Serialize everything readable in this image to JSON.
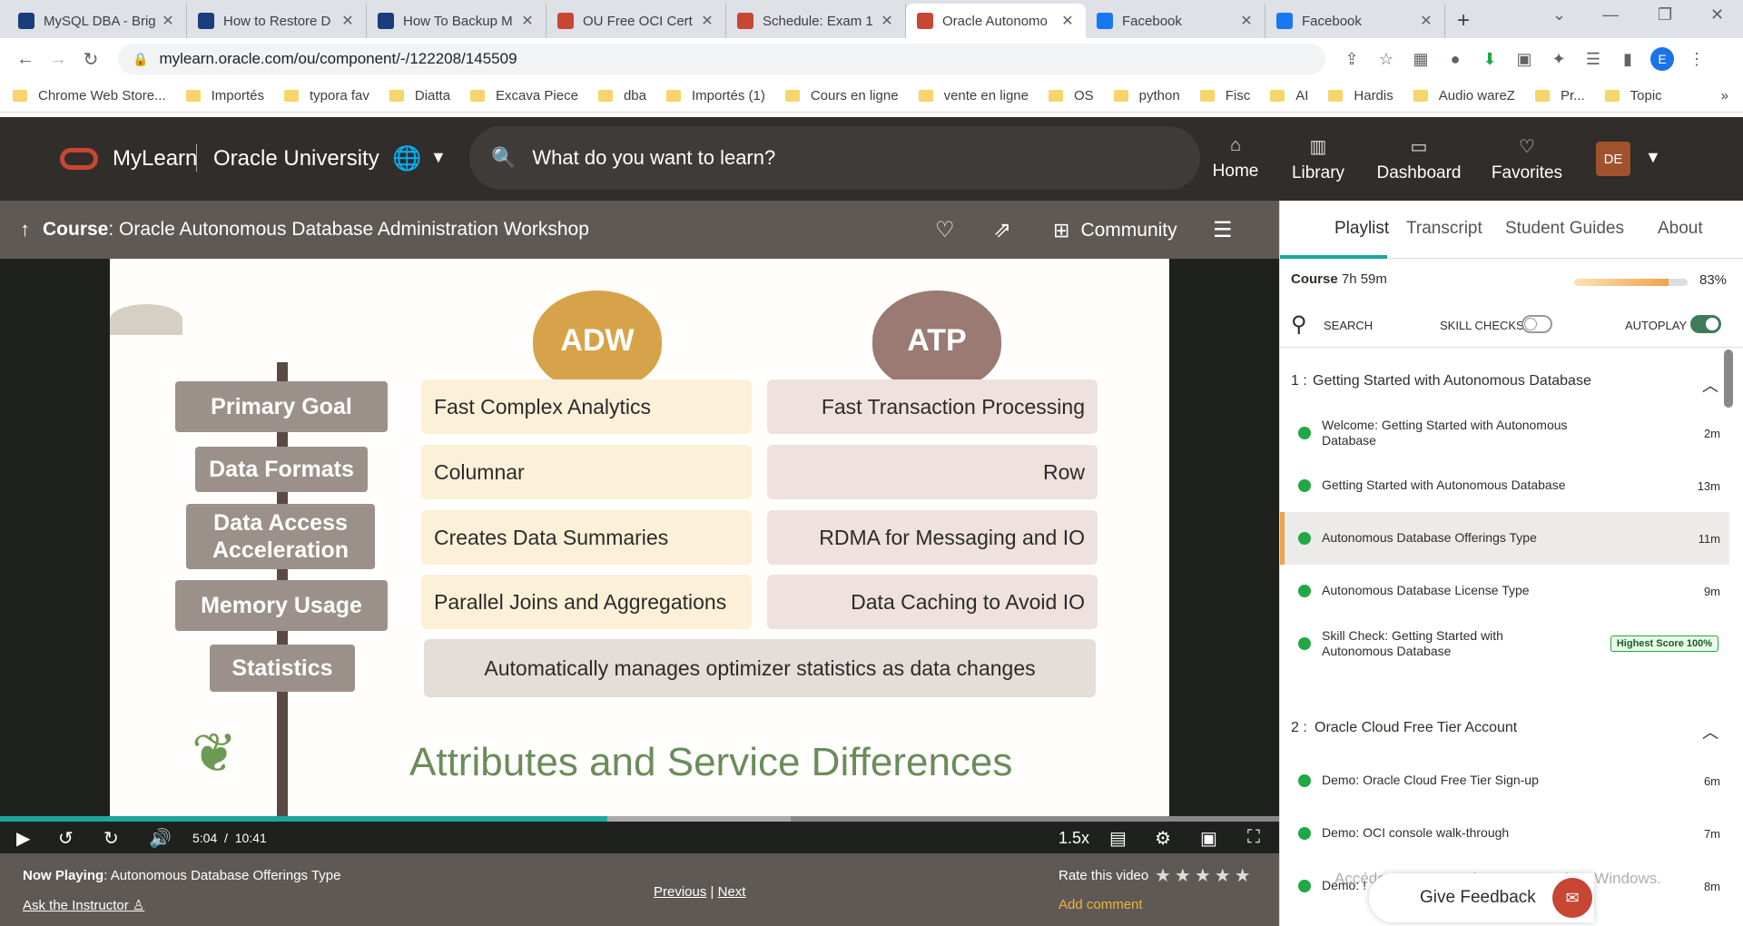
{
  "browser": {
    "tabs": [
      {
        "title": "MySQL DBA - Brig",
        "icon": "web-icon",
        "color": "#1a3e7a"
      },
      {
        "title": "How to Restore D",
        "icon": "web-icon",
        "color": "#1a3e7a"
      },
      {
        "title": "How To Backup M",
        "icon": "web-icon",
        "color": "#1a3e7a"
      },
      {
        "title": "OU Free OCI Cert",
        "icon": "oracle-icon",
        "color": "#c74634"
      },
      {
        "title": "Schedule: Exam 1",
        "icon": "oracle-icon",
        "color": "#c74634"
      },
      {
        "title": "Oracle Autonomo",
        "icon": "oracle-icon",
        "color": "#c74634"
      },
      {
        "title": "Facebook",
        "icon": "facebook-icon",
        "color": "#1877f2"
      },
      {
        "title": "Facebook",
        "icon": "facebook-icon",
        "color": "#1877f2"
      }
    ],
    "active_tab": 5,
    "url": "mylearn.oracle.com/ou/component/-/122208/145509",
    "profile_initial": "E",
    "bookmarks": [
      "Chrome Web Store...",
      "Importés",
      "typora fav",
      "Diatta",
      "Excava Piece",
      "dba",
      "Importés (1)",
      "Cours en ligne",
      "vente en ligne",
      "OS",
      "python",
      "Fisc",
      "AI",
      "Hardis",
      "Audio wareZ",
      "Pr...",
      "Topic"
    ]
  },
  "header": {
    "brand": "MyLearn",
    "org": "Oracle University",
    "search_placeholder": "What do you want to learn?",
    "nav": [
      "Home",
      "Library",
      "Dashboard",
      "Favorites"
    ],
    "user_initials": "DE"
  },
  "course": {
    "prefix": "Course",
    "title": ": Oracle Autonomous Database Administration Workshop",
    "community": "Community"
  },
  "slide": {
    "adw": "ADW",
    "atp": "ATP",
    "signs": [
      "Primary Goal",
      "Data Formats",
      "Data Access Acceleration",
      "Memory Usage",
      "Statistics"
    ],
    "adw_cells": [
      "Fast Complex Analytics",
      "Columnar",
      "Creates Data Summaries",
      "Parallel Joins and Aggregations"
    ],
    "atp_cells": [
      "Fast Transaction Processing",
      "Row",
      "RDMA for Messaging and IO",
      "Data Caching to Avoid IO"
    ],
    "full_cell": "Automatically manages optimizer statistics as data changes",
    "title": "Attributes and Service Differences"
  },
  "player": {
    "current": "5:04",
    "duration": "10:41",
    "played_fraction": 0.475,
    "buffered_fraction": 0.618,
    "speed": "1.5x"
  },
  "now_playing": {
    "label": "Now Playing",
    "title": ": Autonomous Database Offerings Type",
    "ask": "Ask the Instructor",
    "previous": "Previous",
    "divider": "|",
    "next": "Next",
    "rate": "Rate this video",
    "add_comment": "Add comment"
  },
  "panel": {
    "tabs": [
      "Playlist",
      "Transcript",
      "Student Guides",
      "About"
    ],
    "course_label": "Course",
    "course_time": "7h 59m",
    "percent": "83%",
    "percent_value": 0.83,
    "search": "SEARCH",
    "skill_checks": "SKILL CHECKS",
    "autoplay": "AUTOPLAY",
    "sections": [
      {
        "num": "1 :",
        "title": "Getting Started with Autonomous Database"
      },
      {
        "num": "2 :",
        "title": "Oracle Cloud Free Tier Account"
      }
    ],
    "items": [
      {
        "label": "Welcome: Getting Started with Autonomous Database",
        "dur": "2m"
      },
      {
        "label": "Getting Started with Autonomous Database",
        "dur": "13m"
      },
      {
        "label": "Autonomous Database Offerings Type",
        "dur": "11m"
      },
      {
        "label": "Autonomous Database License Type",
        "dur": "9m"
      },
      {
        "label": "Skill Check: Getting Started with Autonomous Database",
        "badge": "Highest Score 100%"
      },
      {
        "label": "Demo: Oracle Cloud Free Tier Sign-up",
        "dur": "6m"
      },
      {
        "label": "Demo: OCI console walk-through",
        "dur": "7m"
      },
      {
        "label": "Demo: !",
        "dur": "8m"
      }
    ]
  },
  "overlay": {
    "watermark": "Accédez aux paramètres pour activer Windows.",
    "feedback": "Give Feedback"
  }
}
